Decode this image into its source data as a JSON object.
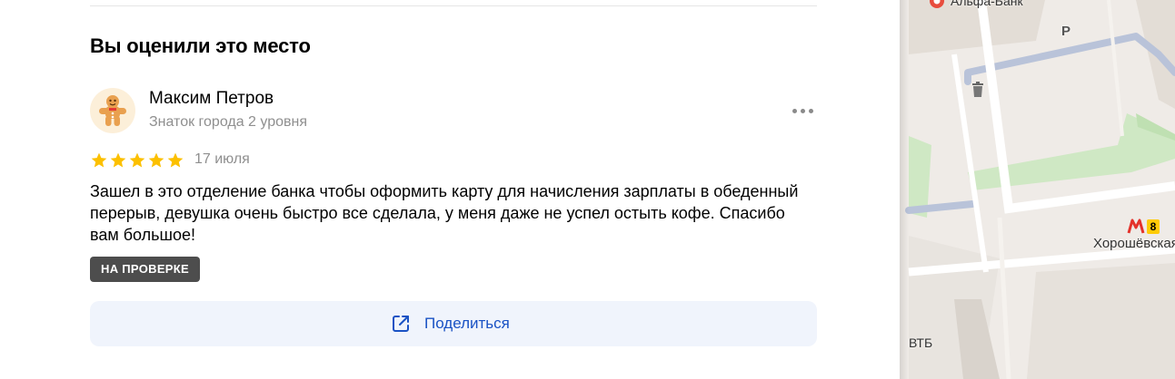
{
  "review_section": {
    "title": "Вы оценили это место",
    "author": {
      "name": "Максим Петров",
      "level": "Знаток города 2 уровня",
      "avatar_icon": "gingerbread-man-icon"
    },
    "rating": 5,
    "rating_max": 5,
    "date": "17 июля",
    "text": "Зашел в это отделение банка чтобы оформить карту для начисления зарплаты в обеденный перерыв, девушка очень быстро все сделала, у меня даже не успел остыть кофе. Спасибо вам большое!",
    "status_badge": "НА ПРОВЕРКЕ",
    "share_label": "Поделиться",
    "share_icon": "external-share-icon",
    "more_icon": "more-dots-icon",
    "star_color": "#fcc000",
    "accent_color": "#1a52c4"
  },
  "map": {
    "labels": {
      "bank_top": "Альфа-Банк",
      "parking": "Р",
      "metro_station": "Хорошёвская",
      "metro_line": "8",
      "bank_bottom": "ВТБ"
    },
    "metro_icon": "metro-m-icon",
    "parking_icon": "parking-icon",
    "trash_icon": "trash-bin-icon",
    "bank_pin_icon": "bank-pin-icon"
  }
}
